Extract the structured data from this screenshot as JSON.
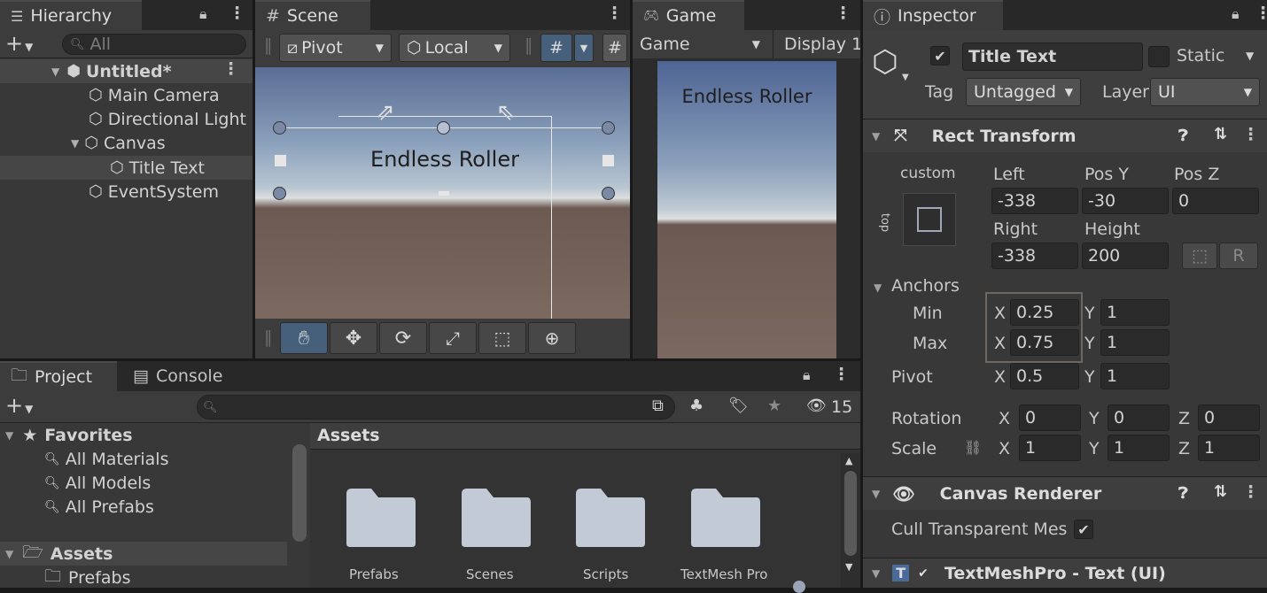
{
  "hierarchy": {
    "tab": "Hierarchy",
    "search_placeholder": "All",
    "scene": "Untitled*",
    "items": [
      "Main Camera",
      "Directional Light",
      "Canvas",
      "Title Text",
      "EventSystem"
    ]
  },
  "scene": {
    "tab": "Scene",
    "pivot": "Pivot",
    "local": "Local",
    "canvas_text": "Endless Roller"
  },
  "game": {
    "tab": "Game",
    "display_select": "Game",
    "display": "Display 1",
    "canvas_text": "Endless Roller"
  },
  "inspector": {
    "tab": "Inspector",
    "object_name": "Title Text",
    "static_label": "Static",
    "tag_label": "Tag",
    "tag_value": "Untagged",
    "layer_label": "Layer",
    "layer_value": "UI",
    "rect": {
      "title": "Rect Transform",
      "preset_label": "custom",
      "preset_side": "top",
      "left_label": "Left",
      "left": "-338",
      "posy_label": "Pos Y",
      "posy": "-30",
      "posz_label": "Pos Z",
      "posz": "0",
      "right_label": "Right",
      "right": "-338",
      "height_label": "Height",
      "height": "200",
      "r_button": "R",
      "anchors_label": "Anchors",
      "min_label": "Min",
      "min_x": "0.25",
      "min_y": "1",
      "max_label": "Max",
      "max_x": "0.75",
      "max_y": "1",
      "pivot_label": "Pivot",
      "pivot_x": "0.5",
      "pivot_y": "1",
      "rotation_label": "Rotation",
      "rot_x": "0",
      "rot_y": "0",
      "rot_z": "0",
      "scale_label": "Scale",
      "scale_x": "1",
      "scale_y": "1",
      "scale_z": "1",
      "x": "X",
      "y": "Y",
      "z": "Z"
    },
    "canvas_renderer": {
      "title": "Canvas Renderer",
      "cull_label": "Cull Transparent Mes"
    },
    "next_component": "TextMeshPro - Text (UI)"
  },
  "project": {
    "tab": "Project",
    "console_tab": "Console",
    "hidden_count": "15",
    "favorites": "Favorites",
    "fav_items": [
      "All Materials",
      "All Models",
      "All Prefabs"
    ],
    "assets_root": "Assets",
    "asset_children": [
      "Prefabs"
    ],
    "breadcrumb": "Assets",
    "folders": [
      "Prefabs",
      "Scenes",
      "Scripts",
      "TextMesh Pro"
    ]
  }
}
